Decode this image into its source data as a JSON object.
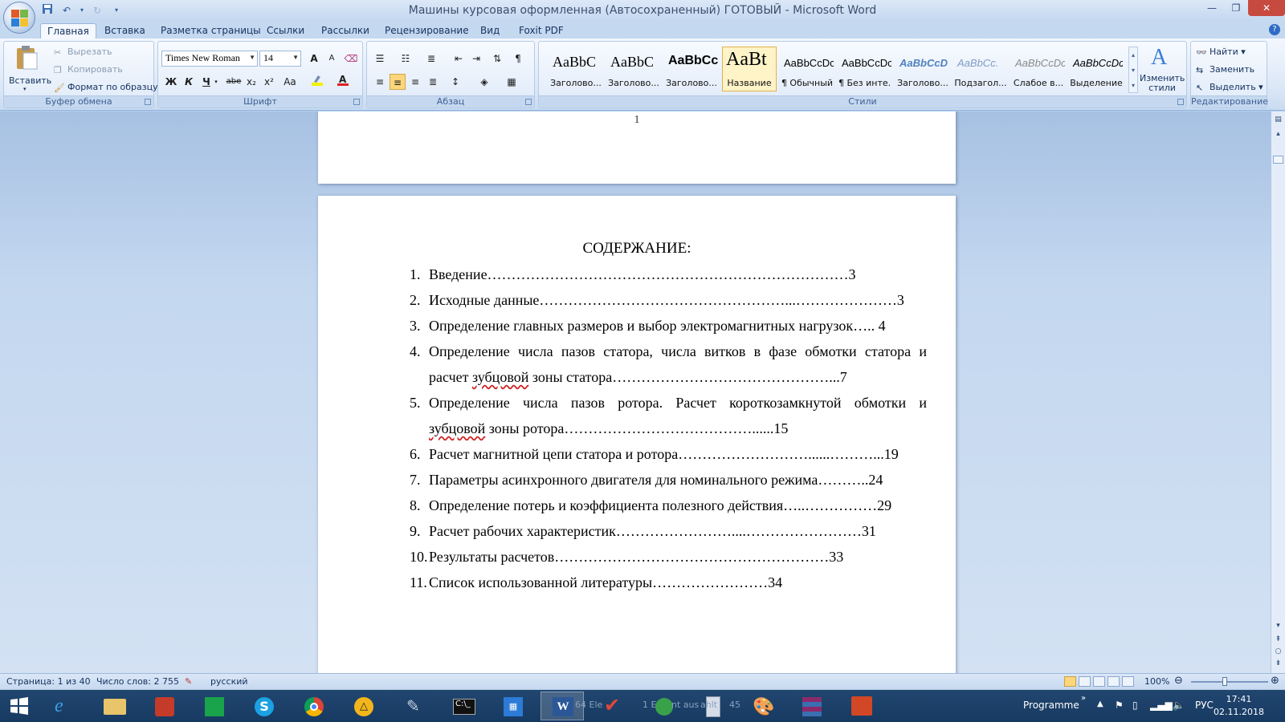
{
  "window": {
    "title": "Машины курсовая оформленная (Автосохраненный) ГОТОВЫЙ - Microsoft Word"
  },
  "tabs": [
    "Главная",
    "Вставка",
    "Разметка страницы",
    "Ссылки",
    "Рассылки",
    "Рецензирование",
    "Вид",
    "Foxit PDF"
  ],
  "ribbon": {
    "clipboard": {
      "label": "Буфер обмена",
      "paste": "Вставить",
      "cut": "Вырезать",
      "copy": "Копировать",
      "format_painter": "Формат по образцу"
    },
    "font": {
      "label": "Шрифт",
      "font_name": "Times New Roman",
      "font_size": "14",
      "bold": "Ж",
      "italic": "К",
      "underline": "Ч",
      "strike": "abe",
      "subscript": "x₂",
      "superscript": "x²",
      "case": "Aa",
      "grow": "A",
      "shrink": "A"
    },
    "paragraph": {
      "label": "Абзац"
    },
    "styles": {
      "label": "Стили",
      "tiles": [
        {
          "sample": "AaBbC",
          "name": "Заголово..."
        },
        {
          "sample": "AaBbC",
          "name": "Заголово..."
        },
        {
          "sample": "AaBbCc",
          "name": "Заголово..."
        },
        {
          "sample": "AaBt",
          "name": "Название"
        },
        {
          "sample": "AaBbCcDc",
          "name": "¶ Обычный"
        },
        {
          "sample": "AaBbCcDc",
          "name": "¶ Без инте..."
        },
        {
          "sample": "AaBbCcD",
          "name": "Заголово..."
        },
        {
          "sample": "AaBbCc.",
          "name": "Подзагол..."
        },
        {
          "sample": "AaBbCcDc",
          "name": "Слабое в..."
        },
        {
          "sample": "AaBbCcDc",
          "name": "Выделение"
        }
      ],
      "change_styles": "Изменить стили"
    },
    "editing": {
      "label": "Редактирование",
      "find": "Найти",
      "replace": "Заменить",
      "select": "Выделить"
    }
  },
  "document": {
    "page1_number": "1",
    "toc_title": "СОДЕРЖАНИЕ:",
    "toc": [
      {
        "num": "1.",
        "text": "Введение…………………………………………………………………3"
      },
      {
        "num": "2.",
        "text": "Исходные данные……………………………………………...…………………3"
      },
      {
        "num": "3.",
        "text": "Определение главных размеров и выбор электромагнитных нагрузок….. 4"
      },
      {
        "num": "4.",
        "line1": "Определение числа пазов статора, числа витков в фазе обмотки статора и",
        "line2_pre": "расчет ",
        "line2_spell": "зубцовой",
        "line2_post": " зоны статора………………………………………...7"
      },
      {
        "num": "5.",
        "line1": "Определение числа пазов ротора. Расчет короткозамкнутой обмотки и",
        "line2_pre": "",
        "line2_spell": "зубцовой",
        "line2_post": " зоны ротора…………………………………......15"
      },
      {
        "num": "6.",
        "text": "Расчет магнитной цепи статора и ротора………………………......………...19"
      },
      {
        "num": "7.",
        "text": "Параметры асинхронного двигателя для номинального режима………..24"
      },
      {
        "num": "8.",
        "text": "Определение потерь и коэффициента полезного действия…..……………29"
      },
      {
        "num": "9.",
        "text": "Расчет рабочих характеристик……………………....……………………31"
      },
      {
        "num": "10.",
        "text": "Результаты расчетов…………………………………………………33"
      },
      {
        "num": "11.",
        "text": "Список использованной литературы……………………34"
      }
    ]
  },
  "status": {
    "page": "Страница: 1 из 40",
    "words": "Число слов: 2 755",
    "language": "русский",
    "zoom": "100%"
  },
  "taskbar": {
    "ghost1": "64 Ele",
    "ghost2": "1 E",
    "ghost3": "nt aus",
    "ghost4": "ahlt",
    "ghost5": "45",
    "programme": "Programme",
    "lang": "РУС",
    "time": "17:41",
    "date": "02.11.2018"
  },
  "colors": {
    "ribbon_bg": "#dbe7f6",
    "accent": "#2d6bc4",
    "title_style_highlight": "#fff3c8"
  }
}
